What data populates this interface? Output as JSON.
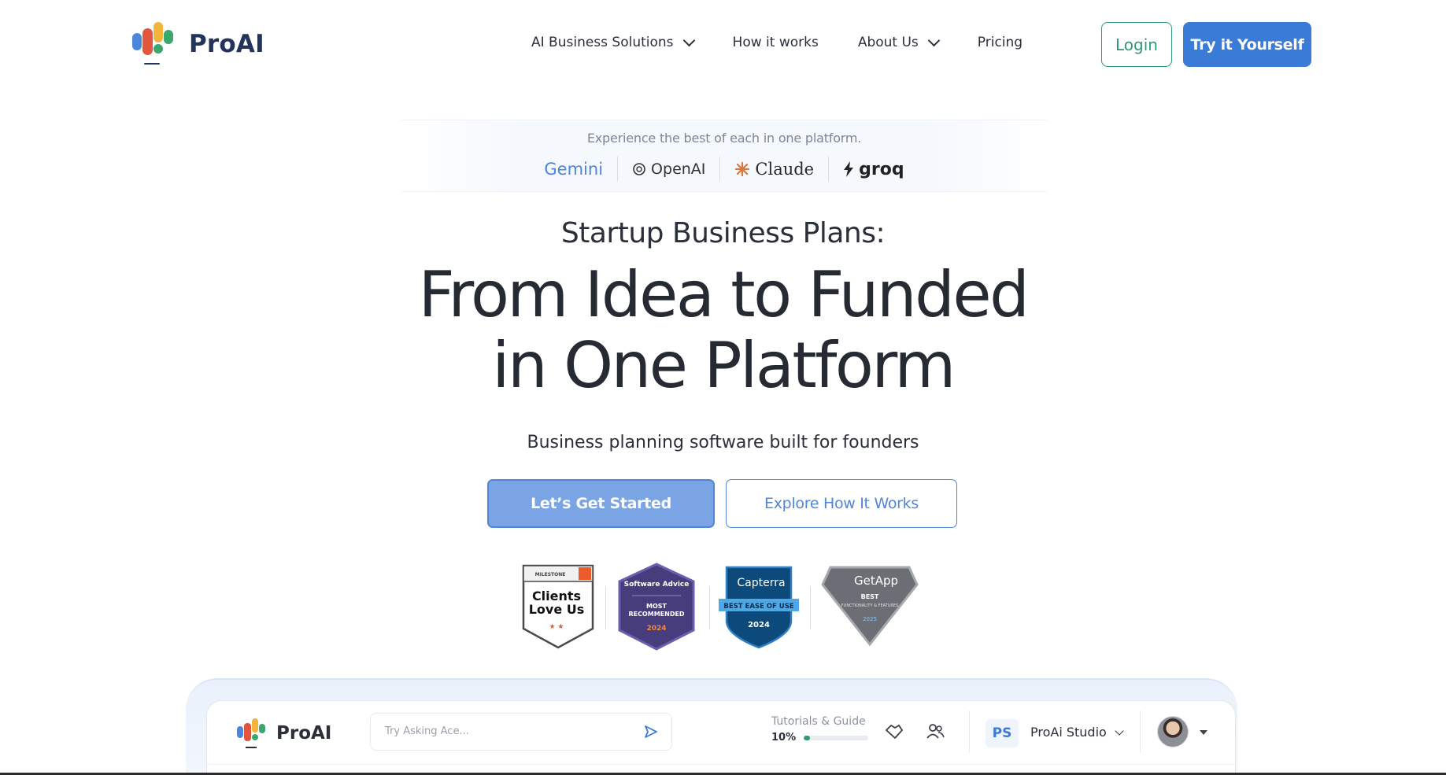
{
  "brand": {
    "name": "ProAI"
  },
  "nav": {
    "items": [
      {
        "label": "AI Business Solutions",
        "has_dropdown": true
      },
      {
        "label": "How it works",
        "has_dropdown": false
      },
      {
        "label": "About Us",
        "has_dropdown": true
      },
      {
        "label": "Pricing",
        "has_dropdown": false
      }
    ],
    "login_label": "Login",
    "try_label": "Try it Yourself"
  },
  "providers": {
    "caption": "Experience the best of each in one platform.",
    "names": [
      "Gemini",
      "OpenAI",
      "Claude",
      "groq"
    ]
  },
  "hero": {
    "subtitle": "Startup Business Plans:",
    "headline_line1": "From Idea to Funded",
    "headline_line2": "in One Platform",
    "tagline": "Business planning software built for founders",
    "primary_cta": "Let’s Get Started",
    "secondary_cta": "Explore How It Works"
  },
  "badges": [
    {
      "top": "MILESTONE",
      "line1": "Clients",
      "line2": "Love Us"
    },
    {
      "top": "Software Advice",
      "line1": "MOST",
      "line2": "RECOMMENDED",
      "year": "2024"
    },
    {
      "top": "Capterra",
      "line1": "BEST EASE OF USE",
      "year": "2024"
    },
    {
      "top": "GetApp",
      "line1": "BEST",
      "line2": "FUNCTIONALITY & FEATURES",
      "year": "2025"
    }
  ],
  "preview": {
    "brand": "ProAI",
    "search_placeholder": "Try Asking Ace...",
    "tutorials_label": "Tutorials & Guide",
    "tutorials_progress": "10%",
    "tutorials_fraction": 0.1,
    "workspace_initials": "PS",
    "workspace_name": "ProAi Studio"
  },
  "colors": {
    "primary": "#3b7bd8",
    "accent_green": "#2f9a71",
    "heading": "#262a33"
  }
}
